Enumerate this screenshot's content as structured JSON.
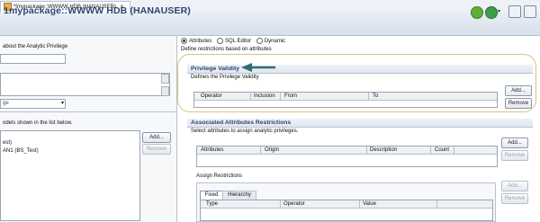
{
  "editor_tab": {
    "label": "*[mypackage::WWWW HDB (HANAUSER)"
  },
  "header": {
    "title": "1mypackage::WWWW HDB (HANAUSER)"
  },
  "left": {
    "intro_text": "about the Analytic Privilege",
    "dropdown_value": "ge",
    "models_text": "odels shown in the list below.",
    "list_items": [
      "est)",
      "AN1 (BS_Test)"
    ],
    "add_label": "Add...",
    "remove_label": "Remove"
  },
  "restriction_mode": {
    "options": [
      "Attributes",
      "SQL Editor",
      "Dynamic"
    ],
    "selected": "Attributes",
    "description": "Define restrictions based on attributes"
  },
  "privilege_validity": {
    "title": "Privilege Validity",
    "subtitle": "Defines the Privilege Validity",
    "columns": [
      "Operator",
      "Inclusion",
      "From",
      "To"
    ],
    "add_label": "Add...",
    "remove_label": "Remove"
  },
  "associated_attributes": {
    "title": "Associated Attributes Restrictions",
    "subtitle": "Select attributes to assign analytic privileges.",
    "columns": [
      "Attributes",
      "Origin",
      "Description",
      "Count"
    ],
    "add_label": "Add...",
    "remove_label": "Remove"
  },
  "assign_restrictions": {
    "title": "Assign Restrictions",
    "tabs": [
      "Fixed",
      "Hierarchy"
    ],
    "selected_tab": "Fixed",
    "columns": [
      "Type",
      "Operator",
      "Value"
    ],
    "add_label": "Add...",
    "remove_label": "Remove"
  },
  "colors": {
    "highlight_ring": "#d8c27a",
    "arrow": "#2f6b70",
    "title_text": "#2c4470"
  }
}
